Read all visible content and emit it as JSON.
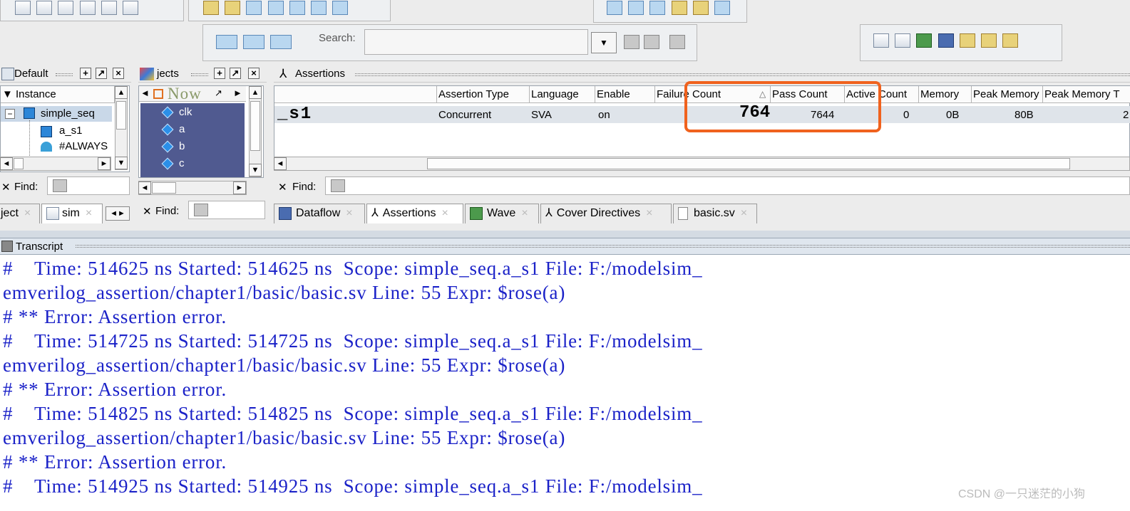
{
  "search": {
    "label": "Search:",
    "value": ""
  },
  "instance_pane": {
    "title": "Default",
    "column_header": "Instance",
    "tree": [
      {
        "label": "simple_seq",
        "expanded": true,
        "level": 0
      },
      {
        "label": "a_s1",
        "level": 1
      },
      {
        "label": "#ALWAYS",
        "level": 1
      }
    ],
    "find_label": "Find:",
    "tabs": [
      {
        "label": "ject"
      },
      {
        "label": "sim"
      }
    ]
  },
  "objects_pane": {
    "title": "jects",
    "now_label": "Now",
    "signals": [
      "clk",
      "a",
      "b",
      "c"
    ],
    "find_label": "Find:"
  },
  "assertions_pane": {
    "title": "Assertions",
    "columns": [
      "Assertion Type",
      "Language",
      "Enable",
      "Failure Count",
      "Pass Count",
      "Active Count",
      "Memory",
      "Peak Memory",
      "Peak Memory T"
    ],
    "row": {
      "name": "_s1",
      "assertion_type": "Concurrent",
      "language": "SVA",
      "enable": "on",
      "failure_count": "764",
      "pass_count": "7644",
      "active_count": "0",
      "memory": "0B",
      "peak_memory": "80B",
      "peak_memory_t": "2"
    },
    "find_label": "Find:",
    "highlight_color": "#f0621e"
  },
  "bottom_tabs": [
    {
      "label": "Dataflow",
      "icon": "dataflow-icon"
    },
    {
      "label": "Assertions",
      "icon": "assertion-icon",
      "active": true
    },
    {
      "label": "Wave",
      "icon": "wave-icon"
    },
    {
      "label": "Cover Directives",
      "icon": "cover-icon"
    },
    {
      "label": "basic.sv",
      "icon": "file-icon"
    }
  ],
  "transcript": {
    "title": "Transcript",
    "lines": [
      "#    Time: 514625 ns Started: 514625 ns  Scope: simple_seq.a_s1 File: F:/modelsim_",
      "emverilog_assertion/chapter1/basic/basic.sv Line: 55 Expr: $rose(a)",
      "# ** Error: Assertion error.",
      "#    Time: 514725 ns Started: 514725 ns  Scope: simple_seq.a_s1 File: F:/modelsim_",
      "emverilog_assertion/chapter1/basic/basic.sv Line: 55 Expr: $rose(a)",
      "# ** Error: Assertion error.",
      "#    Time: 514825 ns Started: 514825 ns  Scope: simple_seq.a_s1 File: F:/modelsim_",
      "emverilog_assertion/chapter1/basic/basic.sv Line: 55 Expr: $rose(a)",
      "# ** Error: Assertion error.",
      "#    Time: 514925 ns Started: 514925 ns  Scope: simple_seq.a_s1 File: F:/modelsim_"
    ],
    "watermark": "CSDN @一只迷茫的小狗"
  }
}
